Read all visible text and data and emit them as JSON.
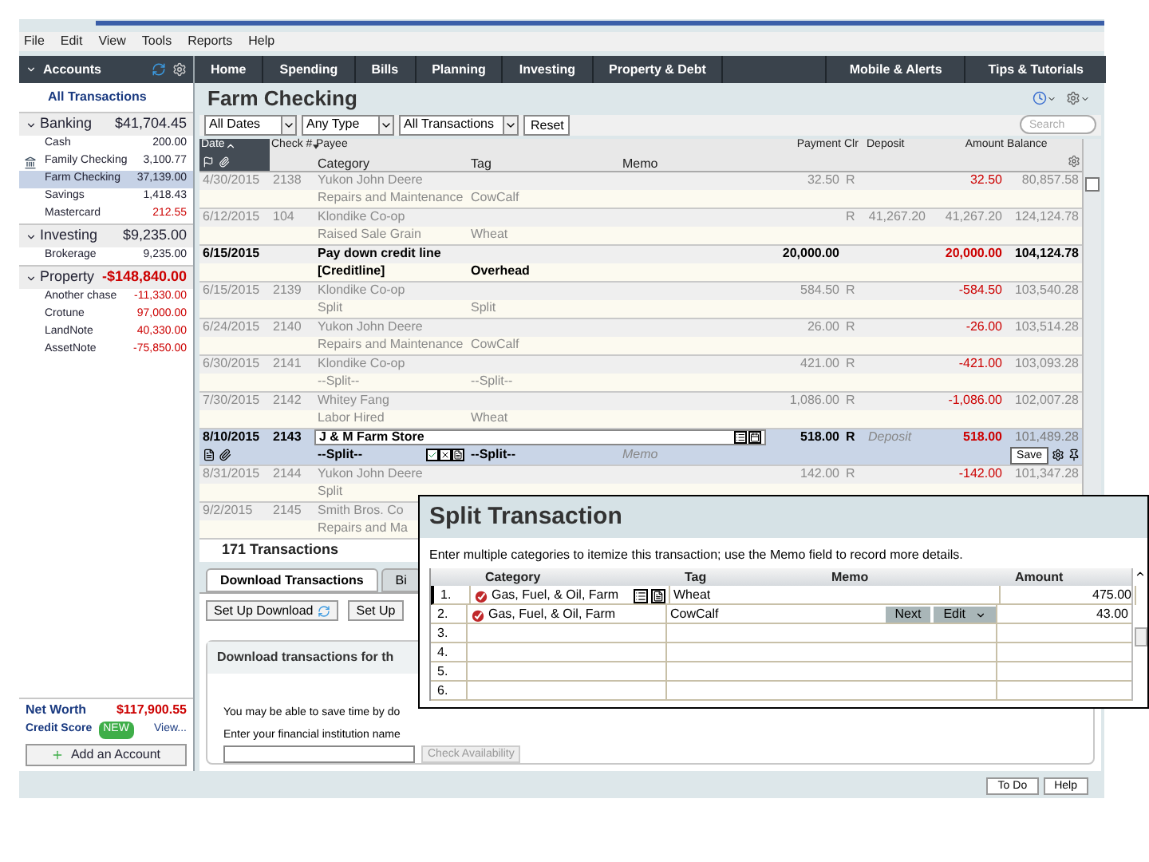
{
  "menu": [
    "File",
    "Edit",
    "View",
    "Tools",
    "Reports",
    "Help"
  ],
  "nav": [
    {
      "label": "Home",
      "kind": "main"
    },
    {
      "label": "Spending",
      "kind": "main"
    },
    {
      "label": "Bills",
      "kind": "main"
    },
    {
      "label": "Planning",
      "kind": "main"
    },
    {
      "label": "Investing",
      "kind": "main"
    },
    {
      "label": "Property & Debt",
      "kind": "main"
    },
    {
      "label": "Mobile & Alerts",
      "kind": "extra"
    },
    {
      "label": "Tips & Tutorials",
      "kind": "extra"
    }
  ],
  "sidebar": {
    "header": "Accounts",
    "all_transactions": "All Transactions",
    "groups": [
      {
        "name": "Banking",
        "total": "$41,704.45",
        "negative": false,
        "expanded": true,
        "items": [
          {
            "name": "Cash",
            "balance": "200.00",
            "negative": false,
            "selected": false,
            "online": false
          },
          {
            "name": "Family Checking",
            "balance": "3,100.77",
            "negative": false,
            "selected": false,
            "online": true
          },
          {
            "name": "Farm Checking",
            "balance": "37,139.00",
            "negative": false,
            "selected": true,
            "online": false
          },
          {
            "name": "Savings",
            "balance": "1,418.43",
            "negative": false,
            "selected": false,
            "online": false
          },
          {
            "name": "Mastercard",
            "balance": "212.55",
            "negative": true,
            "selected": false,
            "online": false
          }
        ]
      },
      {
        "name": "Investing",
        "total": "$9,235.00",
        "negative": false,
        "expanded": true,
        "items": [
          {
            "name": "Brokerage",
            "balance": "9,235.00",
            "negative": false,
            "selected": false,
            "online": false
          }
        ]
      },
      {
        "name": "Property",
        "total": "-$148,840.00",
        "negative": true,
        "expanded": true,
        "items": [
          {
            "name": "Another chase",
            "balance": "-11,330.00",
            "negative": true,
            "selected": false,
            "online": false
          },
          {
            "name": "Crotune",
            "balance": "97,000.00",
            "negative": true,
            "selected": false,
            "online": false
          },
          {
            "name": "LandNote",
            "balance": "40,330.00",
            "negative": true,
            "selected": false,
            "online": false
          },
          {
            "name": "AssetNote",
            "balance": "-75,850.00",
            "negative": true,
            "selected": false,
            "online": false
          }
        ]
      }
    ],
    "net_worth": {
      "label": "Net Worth",
      "value": "$117,900.55"
    },
    "credit_score": {
      "label": "Credit Score",
      "badge": "NEW",
      "link": "View..."
    },
    "add_button": "Add an Account"
  },
  "title": "Farm Checking",
  "filters": [
    {
      "kind": "dropdown",
      "value": "All Dates"
    },
    {
      "kind": "dropdown",
      "value": "Any Type"
    },
    {
      "kind": "dropdown",
      "value": "All Transactions"
    },
    {
      "kind": "button",
      "value": "Reset"
    },
    {
      "kind": "search",
      "placeholder": "Search"
    }
  ],
  "register": {
    "columns": [
      {
        "label": "Date",
        "sorted": true,
        "dropdown": false
      },
      {
        "label": "Check #",
        "sorted": false,
        "dropdown": true
      },
      {
        "label": "Payee",
        "sorted": false,
        "dropdown": false
      },
      {
        "label": "Payment",
        "sorted": false,
        "dropdown": false
      },
      {
        "label": "Clr",
        "sorted": false,
        "dropdown": false
      },
      {
        "label": "Deposit",
        "sorted": false,
        "dropdown": false
      },
      {
        "label": "Amount",
        "sorted": false,
        "dropdown": false
      },
      {
        "label": "Balance",
        "sorted": false,
        "dropdown": false
      }
    ],
    "sub_columns": [
      "Category",
      "Tag",
      "Memo"
    ],
    "rows": [
      {
        "date": "4/30/2015",
        "check": "2138",
        "payee": "Yukon John Deere",
        "category": "Repairs and Maintenance",
        "tag": "CowCalf",
        "payment": "32.50",
        "clr": "R",
        "amount": "32.50",
        "balance": "80,857.58",
        "negative": true,
        "reconciled": true,
        "unreviewed": false,
        "selected": false
      },
      {
        "date": "6/12/2015",
        "check": "104",
        "payee": "Klondike Co-op",
        "category": "Raised Sale Grain",
        "tag": "Wheat",
        "clr": "R",
        "deposit": "41,267.20",
        "amount": "41,267.20",
        "balance": "124,124.78",
        "negative": false,
        "reconciled": true,
        "unreviewed": false,
        "selected": false
      },
      {
        "date": "6/15/2015",
        "payee": "Pay down credit line",
        "category": "[Creditline]",
        "tag": "Overhead",
        "payment": "20,000.00",
        "amount": "20,000.00",
        "balance": "104,124.78",
        "negative": true,
        "reconciled": false,
        "unreviewed": true,
        "selected": false
      },
      {
        "date": "6/15/2015",
        "check": "2139",
        "payee": "Klondike Co-op",
        "category": "Split",
        "tag": "Split",
        "payment": "584.50",
        "clr": "R",
        "amount": "-584.50",
        "balance": "103,540.28",
        "negative": true,
        "reconciled": true,
        "unreviewed": false,
        "selected": false
      },
      {
        "date": "6/24/2015",
        "check": "2140",
        "payee": "Yukon John Deere",
        "category": "Repairs and Maintenance",
        "tag": "CowCalf",
        "payment": "26.00",
        "clr": "R",
        "amount": "-26.00",
        "balance": "103,514.28",
        "negative": true,
        "reconciled": true,
        "unreviewed": false,
        "selected": false
      },
      {
        "date": "6/30/2015",
        "check": "2141",
        "payee": "Klondike Co-op",
        "category": "--Split--",
        "tag": "--Split--",
        "payment": "421.00",
        "clr": "R",
        "amount": "-421.00",
        "balance": "103,093.28",
        "negative": true,
        "reconciled": true,
        "unreviewed": false,
        "selected": false
      },
      {
        "date": "7/30/2015",
        "check": "2142",
        "payee": "Whitey Fang",
        "category": "Labor Hired",
        "tag": "Wheat",
        "payment": "1,086.00",
        "clr": "R",
        "amount": "-1,086.00",
        "balance": "102,007.28",
        "negative": true,
        "reconciled": true,
        "unreviewed": false,
        "selected": false
      },
      {
        "date": "8/10/2015",
        "check": "2143",
        "payee": "J & M Farm Store",
        "category": "--Split--",
        "tag": "--Split--",
        "memo_placeholder": "Memo",
        "payment": "518.00",
        "clr": "R",
        "deposit_placeholder": "Deposit",
        "amount": "518.00",
        "balance": "101,489.28",
        "save": "Save",
        "negative": true,
        "reconciled": true,
        "unreviewed": true,
        "selected": true
      },
      {
        "date": "8/31/2015",
        "check": "2144",
        "payee": "Yukon John Deere",
        "category": "Split",
        "payment": "142.00",
        "clr": "R",
        "amount": "-142.00",
        "balance": "101,347.28",
        "negative": true,
        "reconciled": true,
        "unreviewed": false,
        "selected": false
      },
      {
        "date": "9/2/2015",
        "check": "2145",
        "payee": "Smith Bros. Co",
        "category": "Repairs and Ma",
        "reconciled": true,
        "unreviewed": false,
        "selected": false
      }
    ]
  },
  "count": "171 Transactions",
  "tabs": [
    {
      "label": "Download Transactions",
      "selected": true
    },
    {
      "label": "Bi",
      "selected": false
    }
  ],
  "tab_buttons": [
    "Set Up Download",
    "Set Up"
  ],
  "download": {
    "heading": "Download transactions for th",
    "text": "You may be able to save time by do",
    "field_label": "Enter your financial institution name",
    "button": "Check Availability",
    "button_disabled": true
  },
  "footer_buttons": [
    "To Do",
    "Help"
  ],
  "dialog": {
    "title": "Split Transaction",
    "instruction": "Enter multiple categories to itemize this transaction; use the Memo field to record more details.",
    "columns": [
      "Category",
      "Tag",
      "Memo",
      "Amount"
    ],
    "rows": [
      {
        "num": "1.",
        "category": "Gas, Fuel, & Oil, Farm",
        "tag": "Wheat",
        "amount": "475.00",
        "selected": true
      },
      {
        "num": "2.",
        "category": "Gas, Fuel, & Oil, Farm",
        "tag": "CowCalf",
        "amount": "43.00",
        "actions": [
          "Next",
          "Edit"
        ],
        "selected": false
      },
      {
        "num": "3.",
        "selected": false
      },
      {
        "num": "4.",
        "selected": false
      },
      {
        "num": "5.",
        "selected": false
      },
      {
        "num": "6.",
        "selected": false
      }
    ]
  }
}
